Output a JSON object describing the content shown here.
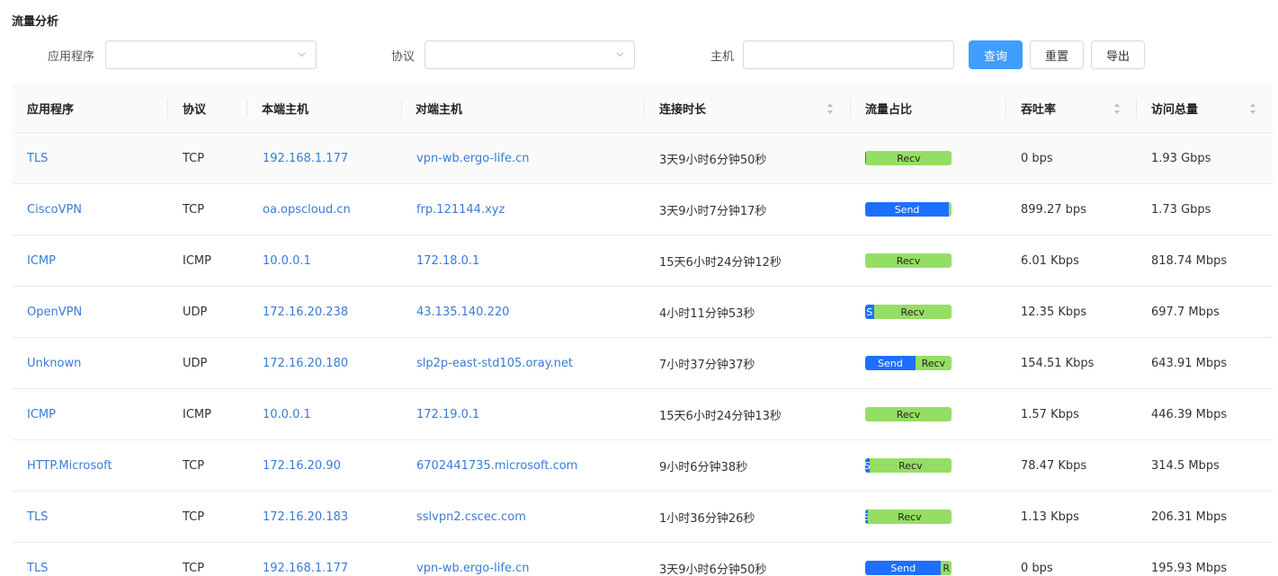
{
  "page": {
    "title": "流量分析"
  },
  "filters": {
    "app_label": "应用程序",
    "protocol_label": "协议",
    "host_label": "主机",
    "app_value": "",
    "protocol_value": "",
    "host_value": ""
  },
  "buttons": {
    "query": "查询",
    "reset": "重置",
    "export": "导出"
  },
  "colors": {
    "primary": "#409eff",
    "link": "#3a7bd5",
    "send": "#1e6fff",
    "recv": "#95de64"
  },
  "table": {
    "headers": {
      "app": "应用程序",
      "protocol": "协议",
      "local_host": "本端主机",
      "remote_host": "对端主机",
      "duration": "连接时长",
      "ratio": "流量占比",
      "throughput": "吞吐率",
      "total": "访问总量"
    },
    "rows": [
      {
        "app": "TLS",
        "protocol": "TCP",
        "local": "192.168.1.177",
        "remote": "vpn-wb.ergo-life.cn",
        "duration": "3天9小时6分钟50秒",
        "send_pct": 1,
        "send_label": "",
        "recv_label": "Recv",
        "throughput": "0 bps",
        "total": "1.93 Gbps"
      },
      {
        "app": "CiscoVPN",
        "protocol": "TCP",
        "local": "oa.opscloud.cn",
        "remote": "frp.121144.xyz",
        "duration": "3天9小时7分钟17秒",
        "send_pct": 97,
        "send_label": "Send",
        "recv_label": "",
        "throughput": "899.27 bps",
        "total": "1.73 Gbps"
      },
      {
        "app": "ICMP",
        "protocol": "ICMP",
        "local": "10.0.0.1",
        "remote": "172.18.0.1",
        "duration": "15天6小时24分钟12秒",
        "send_pct": 0,
        "send_label": "",
        "recv_label": "Recv",
        "throughput": "6.01 Kbps",
        "total": "818.74 Mbps"
      },
      {
        "app": "OpenVPN",
        "protocol": "UDP",
        "local": "172.16.20.238",
        "remote": "43.135.140.220",
        "duration": "4小时11分钟53秒",
        "send_pct": 10,
        "send_label": "S",
        "recv_label": "Recv",
        "throughput": "12.35 Kbps",
        "total": "697.7 Mbps"
      },
      {
        "app": "Unknown",
        "protocol": "UDP",
        "local": "172.16.20.180",
        "remote": "slp2p-east-std105.oray.net",
        "duration": "7小时37分钟37秒",
        "send_pct": 58,
        "send_label": "Send",
        "recv_label": "Recv",
        "throughput": "154.51 Kbps",
        "total": "643.91 Mbps"
      },
      {
        "app": "ICMP",
        "protocol": "ICMP",
        "local": "10.0.0.1",
        "remote": "172.19.0.1",
        "duration": "15天6小时24分钟13秒",
        "send_pct": 0,
        "send_label": "",
        "recv_label": "Recv",
        "throughput": "1.57 Kbps",
        "total": "446.39 Mbps"
      },
      {
        "app": "HTTP.Microsoft",
        "protocol": "TCP",
        "local": "172.16.20.90",
        "remote": "6702441735.microsoft.com",
        "duration": "9小时6分钟38秒",
        "send_pct": 5,
        "send_label": "S",
        "recv_label": "Recv",
        "throughput": "78.47 Kbps",
        "total": "314.5 Mbps"
      },
      {
        "app": "TLS",
        "protocol": "TCP",
        "local": "172.16.20.183",
        "remote": "sslvpn2.cscec.com",
        "duration": "1小时36分钟26秒",
        "send_pct": 3,
        "send_label": "S",
        "recv_label": "Recv",
        "throughput": "1.13 Kbps",
        "total": "206.31 Mbps"
      },
      {
        "app": "TLS",
        "protocol": "TCP",
        "local": "192.168.1.177",
        "remote": "vpn-wb.ergo-life.cn",
        "duration": "3天9小时6分钟50秒",
        "send_pct": 88,
        "send_label": "Send",
        "recv_label": "R",
        "throughput": "0 bps",
        "total": "195.93 Mbps"
      }
    ]
  }
}
